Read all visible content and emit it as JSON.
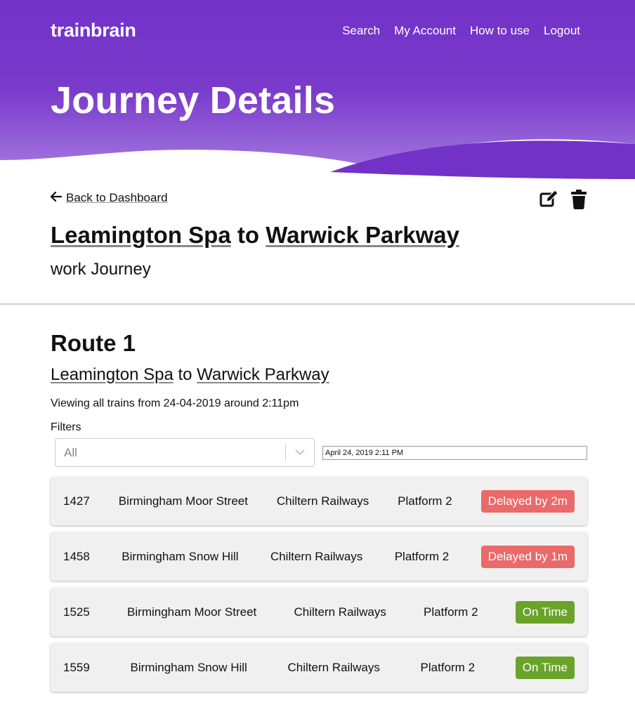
{
  "brand": "trainbrain",
  "nav": [
    "Search",
    "My Account",
    "How to use",
    "Logout"
  ],
  "page_title": "Journey Details",
  "back_link": "Back to Dashboard",
  "journey": {
    "from": "Leamington Spa",
    "connector": "to",
    "to": "Warwick Parkway",
    "subtitle": "work Journey"
  },
  "route": {
    "title": "Route 1",
    "from": "Leamington Spa",
    "connector": "to",
    "to": "Warwick Parkway",
    "viewing_text": "Viewing all trains from 24-04-2019 around 2:11pm"
  },
  "filters": {
    "label": "Filters",
    "select_value": "All",
    "datetime_value": "April 24, 2019 2:11 PM"
  },
  "colors": {
    "header_purple": "#7634c9",
    "delayed": "#ea6a6a",
    "on_time": "#6aa329"
  },
  "trains": [
    {
      "time": "1427",
      "destination": "Birmingham Moor Street",
      "operator": "Chiltern Railways",
      "platform": "Platform 2",
      "status": "Delayed by 2m",
      "status_type": "delayed"
    },
    {
      "time": "1458",
      "destination": "Birmingham Snow Hill",
      "operator": "Chiltern Railways",
      "platform": "Platform 2",
      "status": "Delayed by 1m",
      "status_type": "delayed"
    },
    {
      "time": "1525",
      "destination": "Birmingham Moor Street",
      "operator": "Chiltern Railways",
      "platform": "Platform 2",
      "status": "On Time",
      "status_type": "ontime"
    },
    {
      "time": "1559",
      "destination": "Birmingham Snow Hill",
      "operator": "Chiltern Railways",
      "platform": "Platform 2",
      "status": "On Time",
      "status_type": "ontime"
    }
  ]
}
